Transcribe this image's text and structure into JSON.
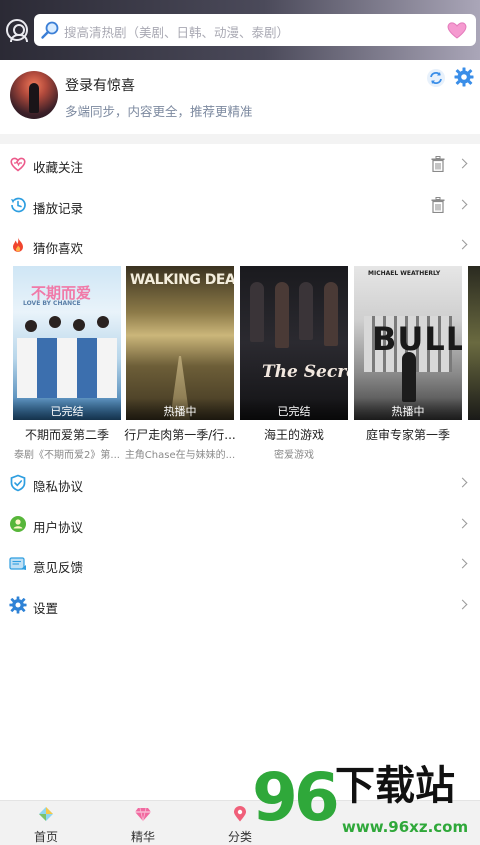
{
  "search": {
    "placeholder": "搜高清热剧（美剧、日韩、动漫、泰剧）"
  },
  "profile": {
    "title": "登录有惊喜",
    "subtitle": "多端同步，内容更全，推荐更精准"
  },
  "menu": {
    "favorites": "收藏关注",
    "history": "播放记录",
    "guess": "猜你喜欢",
    "privacy": "隐私协议",
    "user_agreement": "用户协议",
    "feedback": "意见反馈",
    "settings": "设置"
  },
  "cards": [
    {
      "title": "不期而爱第二季",
      "subtitle": "泰剧《不期而爱2》第...",
      "status": "已完结",
      "poster_text": "不期而爱",
      "poster_sub": "LOVE BY CHANCE"
    },
    {
      "title": "行尸走肉第一季/行...",
      "subtitle": "主角Chase在与妹妹的...",
      "status": "热播中",
      "poster_text": "WALKING DEAD",
      "poster_sub": ""
    },
    {
      "title": "海王的游戏",
      "subtitle": "密爱游戏",
      "status": "已完结",
      "poster_text": "The Secret",
      "poster_sub": ""
    },
    {
      "title": "庭审专家第一季",
      "subtitle": "",
      "status": "热播中",
      "poster_text": "BULL",
      "poster_sub": "MICHAEL WEATHERLY"
    }
  ],
  "tabs": [
    {
      "label": "首页",
      "icon": "home-icon"
    },
    {
      "label": "精华",
      "icon": "diamond-icon"
    },
    {
      "label": "分类",
      "icon": "location-pin-icon"
    }
  ],
  "watermark": {
    "number": "96",
    "title": "下载站",
    "url": "www.96xz.com"
  },
  "colors": {
    "accent": "#2fa83a",
    "blue": "#3a8ee8",
    "pink": "#f06a9a"
  }
}
